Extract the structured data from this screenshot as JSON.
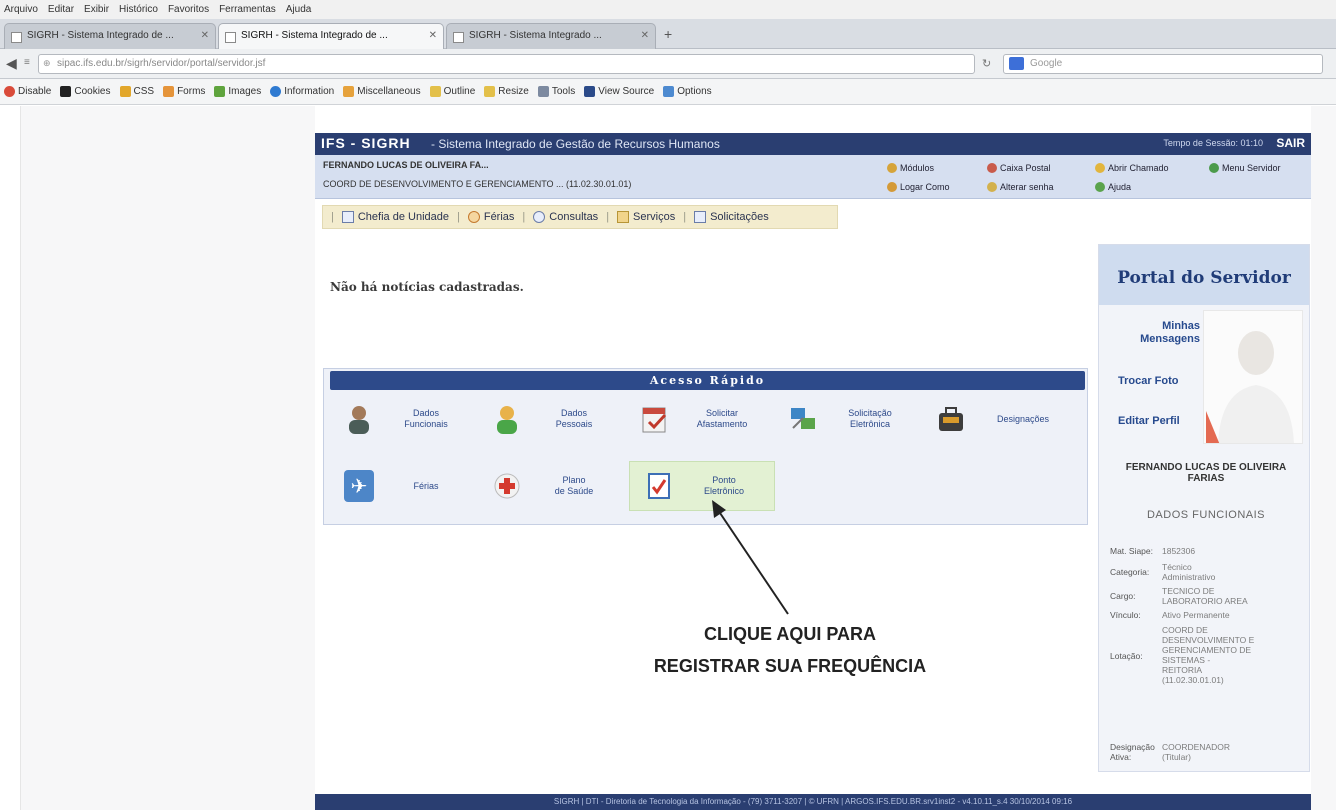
{
  "browser": {
    "menu": [
      "Arquivo",
      "Editar",
      "Exibir",
      "Histórico",
      "Favoritos",
      "Ferramentas",
      "Ajuda"
    ],
    "tabs": [
      {
        "label": "SIGRH - Sistema Integrado de ..."
      },
      {
        "label": "SIGRH - Sistema Integrado de ..."
      },
      {
        "label": "SIGRH - Sistema Integrado ..."
      }
    ],
    "new_tab": "+",
    "url": "sipac.ifs.edu.br/sigrh/servidor/portal/servidor.jsf",
    "search_placeholder": "Google",
    "toolbar": [
      "Disable",
      "Cookies",
      "CSS",
      "Forms",
      "Images",
      "Information",
      "Miscellaneous",
      "Outline",
      "Resize",
      "Tools",
      "View Source",
      "Options"
    ]
  },
  "app": {
    "title": "IFS - SIGRH",
    "subtitle": "- Sistema Integrado de Gestão de Recursos Humanos",
    "session": "Tempo de Sessão: 01:10",
    "logout": "SAIR",
    "user_name": "FERNANDO LUCAS DE OLIVEIRA FA...",
    "unit": "COORD DE DESENVOLVIMENTO E GERENCIAMENTO ... (11.02.30.01.01)",
    "user_buttons": {
      "modulos": "Módulos",
      "caixa_postal": "Caixa Postal",
      "abrir_chamado": "Abrir Chamado",
      "menu_servidor": "Menu Servidor",
      "logar_como": "Logar Como",
      "alterar_senha": "Alterar senha",
      "ajuda": "Ajuda"
    },
    "menu": [
      "Chefia de Unidade",
      "Férias",
      "Consultas",
      "Serviços",
      "Solicitações"
    ],
    "no_news": "Não há notícias cadastradas.",
    "quick_access": {
      "title": "Acesso Rápido",
      "tiles": [
        {
          "label": "Dados\nFuncionais"
        },
        {
          "label": "Dados\nPessoais"
        },
        {
          "label": "Solicitar\nAfastamento"
        },
        {
          "label": "Solicitação\nEletrônica"
        },
        {
          "label": "Designações"
        },
        {
          "label": "Férias"
        },
        {
          "label": "Plano\nde Saúde"
        },
        {
          "label": "Ponto\nEletrônico"
        }
      ]
    },
    "callout": [
      "CLIQUE AQUI PARA",
      "REGISTRAR SUA FREQUÊNCIA"
    ],
    "portal": {
      "title": "Portal do Servidor",
      "links": [
        "Minhas\nMensagens",
        "Trocar Foto",
        "Editar Perfil"
      ],
      "name": "FERNANDO LUCAS DE OLIVEIRA FARIAS",
      "functional_title": "DADOS FUNCIONAIS",
      "fields": [
        {
          "k": "Mat. Siape:",
          "v": "1852306"
        },
        {
          "k": "Categoria:",
          "v": "Técnico\nAdministrativo"
        },
        {
          "k": "Cargo:",
          "v": "TECNICO DE\nLABORATORIO AREA"
        },
        {
          "k": "Vínculo:",
          "v": "Ativo Permanente"
        },
        {
          "k": "Lotação:",
          "v": "COORD DE\nDESENVOLVIMENTO E\nGERENCIAMENTO DE\nSISTEMAS -\nREITORIA\n(11.02.30.01.01)"
        },
        {
          "k": "Designação\nAtiva:",
          "v": "COORDENADOR\n(Titular)"
        }
      ]
    },
    "footer": "SIGRH | DTI - Diretoria de Tecnologia da Informação - (79) 3711-3207 | © UFRN | ARGOS.IFS.EDU.BR.srv1inst2 - v4.10.11_s.4 30/10/2014 09:16"
  },
  "colors": {
    "header": "#2a3e71",
    "accent": "#2d4a8a",
    "menu_bg": "#f3ecce",
    "highlight_tile": "#e3f1d3"
  }
}
